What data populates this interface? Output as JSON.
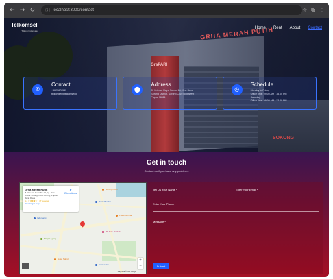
{
  "browser": {
    "url": "localhost:3000/contact",
    "icons": {
      "back": "arrow-left-icon",
      "forward": "arrow-right-icon",
      "reload": "reload-icon",
      "info": "site-info-icon",
      "bookmark": "star-icon",
      "extensions": "puzzle-icon",
      "profile": "profile-icon"
    }
  },
  "nav": {
    "brand": "Telkomsel",
    "brand_tag": "Telkom Indonesia",
    "links": [
      {
        "label": "Home",
        "active": false
      },
      {
        "label": "Rent",
        "active": false
      },
      {
        "label": "About",
        "active": false
      },
      {
        "label": "Contact",
        "active": true
      }
    ]
  },
  "hero": {
    "sign_main": "GRHA MERAH PUTIH",
    "sign_grapari": "GraPARI",
    "sign_side": "SOKONG"
  },
  "cards": [
    {
      "icon": "phone-icon",
      "title": "Contact",
      "lines": [
        "+6225876543",
        "telkomsel@telkomsel.id"
      ]
    },
    {
      "icon": "location-pin-icon",
      "title": "Address",
      "lines": [
        "Jl. Veteran Raya Nomor 18, Kec. Baru,",
        "Sorong District, Sorong City, Southwest",
        "Papua 98411"
      ]
    },
    {
      "icon": "clock-icon",
      "title": "Schedule",
      "lines": [
        "Monday to Friday",
        "Office time: 09.00 AM - 18.00 PM",
        "Saturday",
        "Office time: 09.00 AM - 12.00 PM"
      ]
    }
  ],
  "contact": {
    "title": "Get in touch",
    "subtitle": "Contact us if you have any problems"
  },
  "map": {
    "place_name": "Grha Merah Putih",
    "place_address": [
      "Jl. Veteran Raya No.18, Kp. Baru,",
      "Distrik Sorong, Kota Sorong, Papua",
      "Barat Daya"
    ],
    "rating": "4.4 ★★★★☆ · 77 reviews",
    "larger_map": "View larger map",
    "directions": "Directions",
    "pois": [
      "Sorong Hotel",
      "Bank Mandiri",
      "Indomaret",
      "Pasar Sentral",
      "Masjid Agung",
      "RS Sele Be Solu",
      "Hotel Sahid",
      "Kantor Pos"
    ],
    "attribution": "Map data ©2024 Google",
    "zoom_in": "+",
    "zoom_out": "−"
  },
  "form": {
    "name_label": "Tell Us Your Name *",
    "email_label": "Enter Your Email *",
    "phone_label": "Enter Your Phone",
    "message_label": "Message *",
    "submit": "Submit"
  }
}
